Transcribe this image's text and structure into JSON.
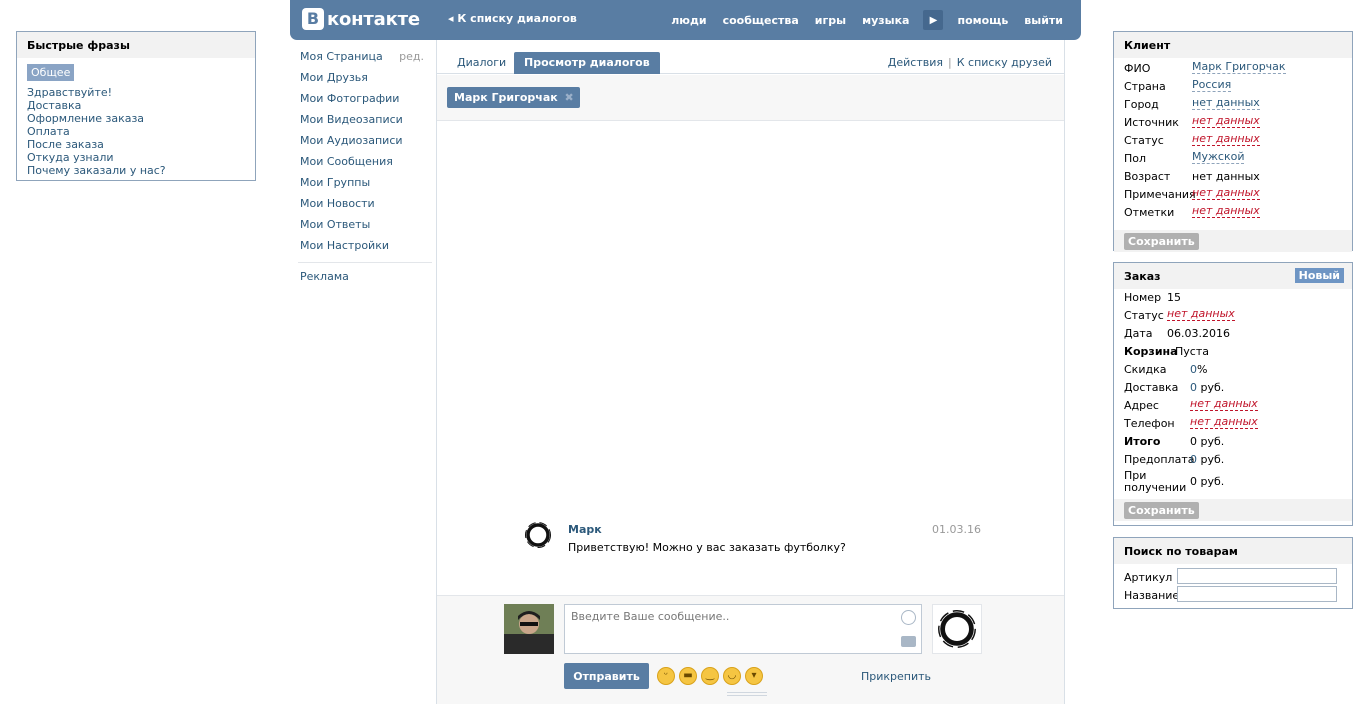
{
  "quick": {
    "title": "Быстрые фразы",
    "tag": "Общее",
    "items": [
      "Здравствуйте!",
      "Доставка",
      "Оформление заказа",
      "Оплата",
      "После заказа",
      "Откуда узнали",
      "Почему заказали у нас?"
    ]
  },
  "header": {
    "logo_letter": "В",
    "logo_text": "контакте",
    "back": "К списку диалогов",
    "nav": [
      "люди",
      "сообщества",
      "игры",
      "музыка",
      "помощь",
      "выйти"
    ]
  },
  "sidebar": {
    "items": [
      "Моя Страница",
      "Мои Друзья",
      "Мои Фотографии",
      "Мои Видеозаписи",
      "Мои Аудиозаписи",
      "Мои Сообщения",
      "Мои Группы",
      "Мои Новости",
      "Мои Ответы",
      "Мои Настройки"
    ],
    "edit": "ред.",
    "ads": "Реклама"
  },
  "tabs": {
    "dialogs": "Диалоги",
    "view": "Просмотр диалогов",
    "actions": "Действия",
    "friends": "К списку друзей",
    "divider": "|"
  },
  "peer": {
    "name": "Марк Григорчак"
  },
  "message": {
    "author": "Марк",
    "date": "01.03.16",
    "text": "Приветствую! Можно у вас заказать футболку?"
  },
  "composer": {
    "placeholder": "Введите Ваше сообщение..",
    "send": "Отправить",
    "attach": "Прикрепить"
  },
  "client": {
    "title": "Клиент",
    "fio_label": "ФИО",
    "fio": "Марк Григорчак",
    "country_label": "Страна",
    "country": "Россия",
    "city_label": "Город",
    "city": "нет данных",
    "source_label": "Источник",
    "source": "нет данных",
    "status_label": "Статус",
    "status": "нет данных",
    "gender_label": "Пол",
    "gender": "Мужской",
    "age_label": "Возраст",
    "age": "нет данных",
    "notes_label": "Примечания",
    "notes": "нет данных",
    "marks_label": "Отметки",
    "marks": "нет данных",
    "save": "Сохранить"
  },
  "order": {
    "title": "Заказ",
    "badge": "Новый",
    "number_label": "Номер",
    "number": "15",
    "status_label": "Статус",
    "status": "нет данных",
    "date_label": "Дата",
    "date": "06.03.2016",
    "cart_label": "Корзина",
    "cart": "Пуста",
    "discount_label": "Скидка",
    "discount": "0",
    "discount_unit": "%",
    "delivery_label": "Доставка",
    "delivery": "0",
    "delivery_unit": " руб.",
    "address_label": "Адрес",
    "address": "нет данных",
    "phone_label": "Телефон",
    "phone": "нет данных",
    "total_label": "Итого",
    "total": "0 руб.",
    "prepay_label": "Предоплата",
    "prepay": "0",
    "prepay_unit": " руб.",
    "onreceive_label1": "При",
    "onreceive_label2": "получении",
    "onreceive": "0 руб.",
    "save": "Сохранить"
  },
  "search": {
    "title": "Поиск по товарам",
    "article_label": "Артикул",
    "name_label": "Название"
  },
  "colors": {
    "brand": "#597da3",
    "link": "#2b587a",
    "empty": "#c0142a"
  }
}
